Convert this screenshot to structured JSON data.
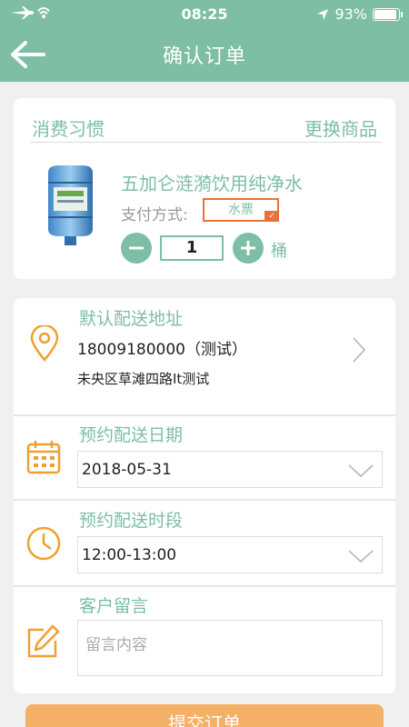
{
  "status_bar": {
    "time": "08:25",
    "battery": "93%"
  },
  "header": {
    "title": "确认订单"
  },
  "product_section": {
    "title": "消费习惯",
    "change_label": "更换商品",
    "product_name": "五加仑涟漪饮用纯净水",
    "pay_label": "支付方式:",
    "pay_value": "水票",
    "quantity": "1",
    "unit": "桶"
  },
  "address": {
    "title": "默认配送地址",
    "phone": "18009180000（测试）",
    "detail": "未央区草滩四路It测试"
  },
  "date": {
    "title": "预约配送日期",
    "value": "2018-05-31"
  },
  "time_slot": {
    "title": "预约配送时段",
    "value": "12:00-13:00"
  },
  "comment": {
    "title": "客户留言",
    "placeholder": "留言内容"
  },
  "submit_label": "提交订单",
  "colors": {
    "primary": "#7dbea4",
    "accent": "#f4b066",
    "icon_orange": "#f0a030",
    "tag_border": "#e8723a"
  }
}
